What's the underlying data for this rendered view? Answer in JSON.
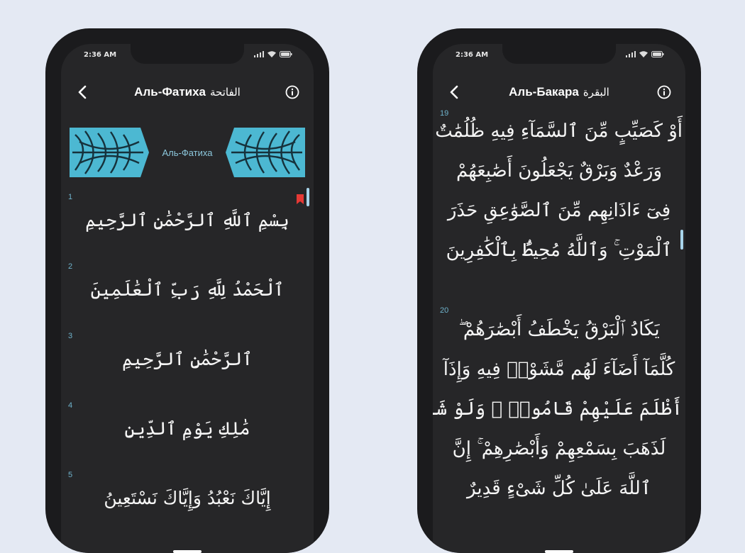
{
  "phones": {
    "left": {
      "status_time": "2:36 AM",
      "title_ru": "Аль-Фатиха",
      "title_ar": "الفاتحة",
      "banner_text": "Аль-Фатиха",
      "verses": [
        {
          "number": "1",
          "text": "بِسْمِ ٱللَّهِ ٱلرَّحْمَٰنِ ٱلرَّحِيمِ"
        },
        {
          "number": "2",
          "text": "ٱلْحَمْدُ لِلَّهِ رَبِّ ٱلْعَٰلَمِينَ"
        },
        {
          "number": "3",
          "text": "ٱلرَّحْمَٰنِ ٱلرَّحِيمِ"
        },
        {
          "number": "4",
          "text": "مَٰلِكِ يَوْمِ ٱلدِّينِ"
        },
        {
          "number": "5",
          "text": "إِيَّاكَ نَعْبُدُ وَإِيَّاكَ نَسْتَعِينُ"
        }
      ]
    },
    "right": {
      "status_time": "2:36 AM",
      "title_ru": "Аль-Бакара",
      "title_ar": "البقرة",
      "ayat": [
        {
          "number": "19",
          "lines": [
            "أَوْ كَصَيِّبٍ مِّنَ ٱلسَّمَآءِ فِيهِ ظُلُمَٰتٌ",
            "وَرَعْدٌ وَبَرْقٌ يَجْعَلُونَ أَصَٰبِعَهُمْ",
            "فِىٓ ءَاذَانِهِم مِّنَ ٱلصَّوَٰعِقِ حَذَرَ",
            "ٱلْمَوْتِ ۚ وَٱللَّهُ مُحِيطٌۢ بِٱلْكَٰفِرِينَ"
          ]
        },
        {
          "number": "20",
          "lines": [
            "يَكَادُ ٱلْبَرْقُ يَخْطَفُ أَبْصَٰرَهُمْ ۖ",
            "كُلَّمَآ أَضَآءَ لَهُم مَّشَوْا۟ فِيهِ وَإِذَآ",
            "أَظْلَمَ عَلَيْهِمْ قَامُوا۟ ۚ وَلَوْ شَآءَ ٱللَّهُ",
            "لَذَهَبَ بِسَمْعِهِمْ وَأَبْصَٰرِهِمْ ۚ إِنَّ",
            "ٱللَّهَ عَلَىٰ كُلِّ شَىْءٍ قَدِيرٌ"
          ]
        }
      ]
    }
  },
  "colors": {
    "background": "#e4e9f3",
    "screen": "#262628",
    "accent_blue": "#6fb3cc",
    "bookmark_red": "#e53935",
    "ornament": "#4cb8d2"
  },
  "icons": {
    "back": "chevron-left-icon",
    "info": "info-icon",
    "bookmark": "bookmark-icon"
  }
}
